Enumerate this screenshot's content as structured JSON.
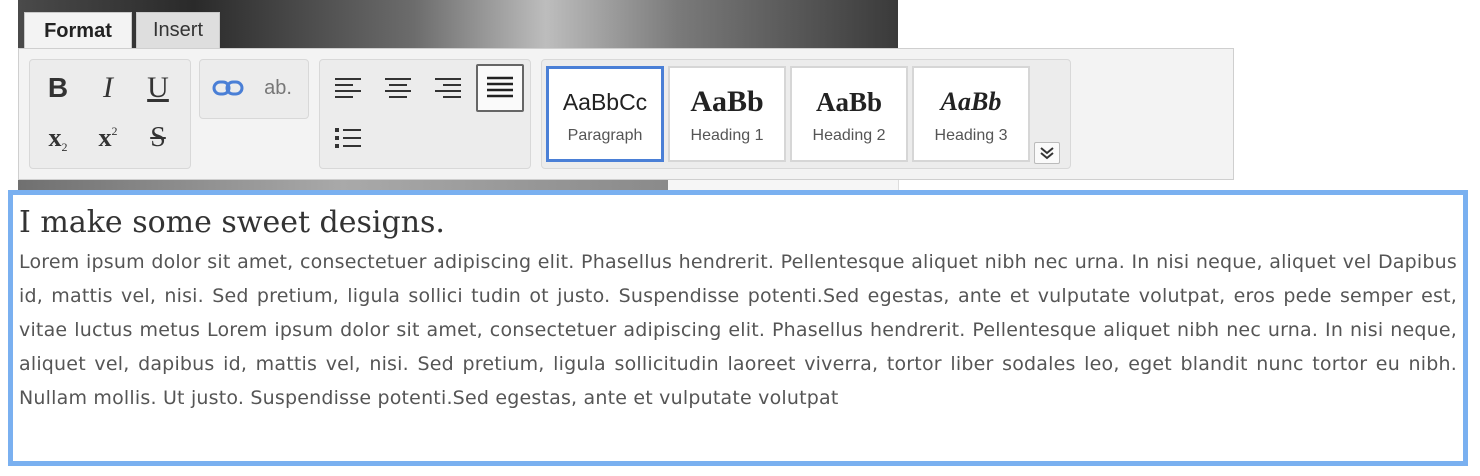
{
  "tabs": [
    {
      "label": "Format",
      "active": true
    },
    {
      "label": "Insert",
      "active": false
    }
  ],
  "toolbar": {
    "text_style": {
      "bold": "B",
      "italic": "I",
      "underline": "U",
      "subscript": "x",
      "superscript": "x",
      "strikethrough": "S"
    },
    "link_icon": "link-icon",
    "clear_format": "ab.",
    "align_left_icon": "align-left-icon",
    "align_center_icon": "align-center-icon",
    "align_right_icon": "align-right-icon",
    "justify_icon": "justify-icon",
    "list_icon": "bullet-list-icon",
    "styles": [
      {
        "sample": "AaBbCc",
        "label": "Paragraph",
        "selected": true
      },
      {
        "sample": "AaBb",
        "label": "Heading 1",
        "selected": false
      },
      {
        "sample": "AaBb",
        "label": "Heading 2",
        "selected": false
      },
      {
        "sample": "AaBb",
        "label": "Heading 3",
        "selected": false
      }
    ],
    "more_styles_icon": "double-chevron-down-icon"
  },
  "editor": {
    "heading": "I make some sweet designs.",
    "body": "Lorem ipsum dolor sit amet, consectetuer adipiscing elit. Phasellus hendrerit. Pellentesque aliquet nibh nec urna. In nisi neque, aliquet vel Dapibus id, mattis vel, nisi. Sed pretium, ligula sollici tudin ot justo. Suspendisse potenti.Sed egestas, ante et vulputate volutpat, eros pede semper est, vitae luctus metus Lorem ipsum dolor sit amet, consectetuer adipiscing elit. Phasellus hendrerit. Pellentesque aliquet nibh nec urna. In nisi neque, aliquet vel, dapibus id, mattis vel, nisi. Sed pretium, ligula sollicitudin laoreet viverra, tortor liber sodales leo, eget blandit nunc tortor eu nibh. Nullam mollis. Ut justo. Suspendisse potenti.Sed egestas, ante et vulputate volutpat"
  },
  "colors": {
    "editor_border": "#7ab0f0",
    "selected_tile": "#4a7fd6"
  }
}
